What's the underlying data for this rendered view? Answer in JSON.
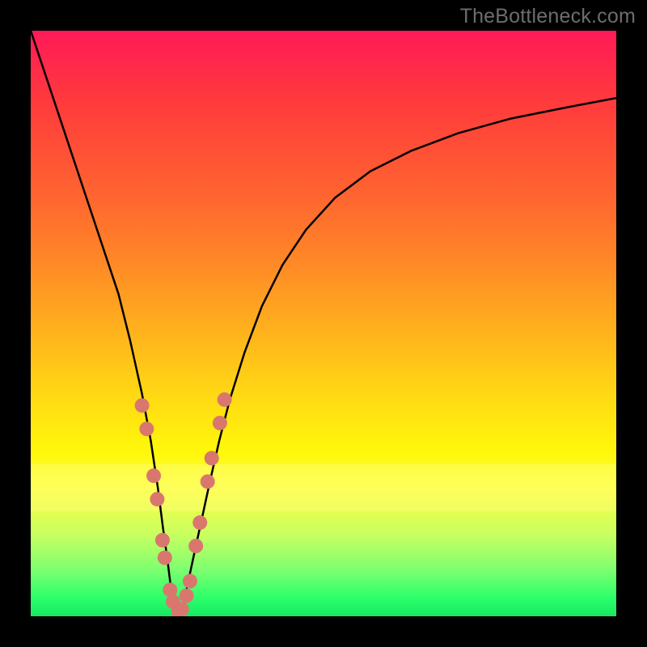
{
  "watermark": "TheBottleneck.com",
  "chart_data": {
    "type": "line",
    "title": "",
    "xlabel": "",
    "ylabel": "",
    "xlim": [
      0,
      100
    ],
    "ylim": [
      0,
      100
    ],
    "series": [
      {
        "name": "curve",
        "x": [
          0,
          3,
          6,
          9,
          12,
          15,
          17,
          19,
          20.5,
          21.7,
          22.6,
          23.3,
          23.8,
          24.2,
          24.6,
          25,
          25.5,
          26,
          26.6,
          27.3,
          28.2,
          29.3,
          30.6,
          32.2,
          34,
          36.5,
          39.5,
          43,
          47,
          52,
          58,
          65,
          73,
          82,
          92,
          100
        ],
        "y": [
          100,
          91,
          82,
          73,
          64,
          55,
          47,
          38,
          30,
          22,
          15,
          10,
          6,
          3.2,
          1.6,
          0.6,
          0.8,
          2,
          4.5,
          7.8,
          12,
          17,
          23,
          30,
          37,
          45,
          53,
          60,
          66,
          71.5,
          76,
          79.5,
          82.5,
          85,
          87,
          88.5
        ]
      }
    ],
    "markers": {
      "name": "dots",
      "color": "#d9776f",
      "points": [
        {
          "x": 19.0,
          "y": 36
        },
        {
          "x": 19.8,
          "y": 32
        },
        {
          "x": 21.0,
          "y": 24
        },
        {
          "x": 21.6,
          "y": 20
        },
        {
          "x": 22.5,
          "y": 13
        },
        {
          "x": 22.9,
          "y": 10
        },
        {
          "x": 23.8,
          "y": 4.5
        },
        {
          "x": 24.3,
          "y": 2.5
        },
        {
          "x": 25.2,
          "y": 0.8
        },
        {
          "x": 25.8,
          "y": 1.2
        },
        {
          "x": 26.6,
          "y": 3.5
        },
        {
          "x": 27.2,
          "y": 6.0
        },
        {
          "x": 28.2,
          "y": 12
        },
        {
          "x": 28.9,
          "y": 16
        },
        {
          "x": 30.2,
          "y": 23
        },
        {
          "x": 30.9,
          "y": 27
        },
        {
          "x": 32.3,
          "y": 33
        },
        {
          "x": 33.1,
          "y": 37
        }
      ]
    },
    "gradient_stops": [
      {
        "pos": 0,
        "color": "#ff1a58"
      },
      {
        "pos": 50,
        "color": "#ffc518"
      },
      {
        "pos": 75,
        "color": "#ffff40"
      },
      {
        "pos": 100,
        "color": "#18e860"
      }
    ]
  }
}
